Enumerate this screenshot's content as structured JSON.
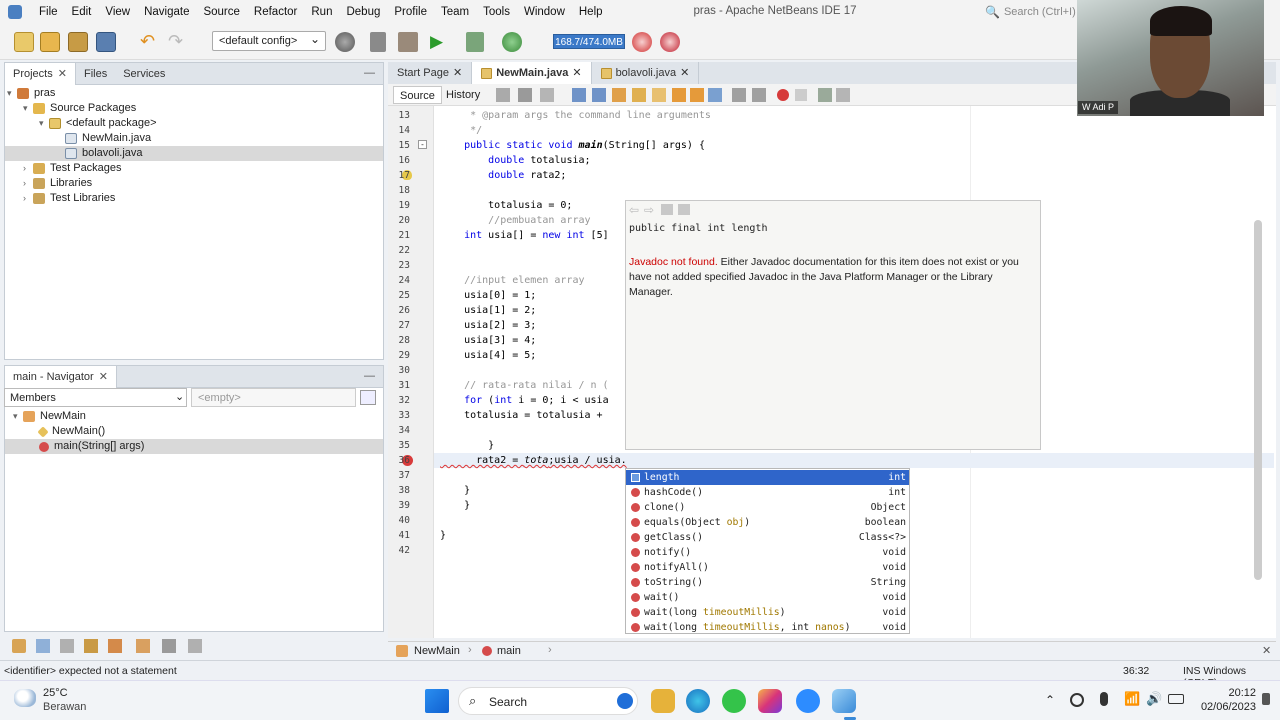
{
  "window": {
    "title": "pras - Apache NetBeans IDE 17"
  },
  "menu": [
    "File",
    "Edit",
    "View",
    "Navigate",
    "Source",
    "Refactor",
    "Run",
    "Debug",
    "Profile",
    "Team",
    "Tools",
    "Window",
    "Help"
  ],
  "search": {
    "placeholder": "Search (Ctrl+I)"
  },
  "toolbar": {
    "config": "<default config>",
    "memory": "168.7/474.0MB"
  },
  "projects_panel": {
    "tabs": [
      "Projects",
      "Files",
      "Services"
    ],
    "tree": [
      "pras",
      "Source Packages",
      "<default package>",
      "NewMain.java",
      "bolavoli.java",
      "Test Packages",
      "Libraries",
      "Test Libraries"
    ]
  },
  "navigator": {
    "title": "main - Navigator",
    "filter": "Members",
    "empty": "<empty>",
    "tree": [
      "NewMain",
      "NewMain()",
      "main(String[] args)"
    ]
  },
  "editor": {
    "tabs": [
      "Start Page",
      "NewMain.java",
      "bolavoli.java"
    ],
    "source_tab": "Source",
    "history_tab": "History",
    "lines": [
      {
        "n": "13",
        "t": "     * @param args the command line arguments"
      },
      {
        "n": "14",
        "t": "     */"
      },
      {
        "n": "15",
        "t": "    public static void main(String[] args) {"
      },
      {
        "n": "16",
        "t": "        double totalusia;"
      },
      {
        "n": "17",
        "t": "        double rata2;"
      },
      {
        "n": "18",
        "t": ""
      },
      {
        "n": "19",
        "t": "        totalusia = 0;"
      },
      {
        "n": "20",
        "t": "        //pembuatan array"
      },
      {
        "n": "21",
        "t": "    int usia[] = new int [5]"
      },
      {
        "n": "22",
        "t": ""
      },
      {
        "n": "23",
        "t": ""
      },
      {
        "n": "24",
        "t": "    //input elemen array"
      },
      {
        "n": "25",
        "t": "    usia[0] = 1;"
      },
      {
        "n": "26",
        "t": "    usia[1] = 2;"
      },
      {
        "n": "27",
        "t": "    usia[2] = 3;"
      },
      {
        "n": "28",
        "t": "    usia[3] = 4;"
      },
      {
        "n": "29",
        "t": "    usia[4] = 5;"
      },
      {
        "n": "30",
        "t": ""
      },
      {
        "n": "31",
        "t": "    // rata-rata nilai / n ("
      },
      {
        "n": "32",
        "t": "    for (int i = 0; i < usia"
      },
      {
        "n": "33",
        "t": "    totalusia = totalusia + "
      },
      {
        "n": "34",
        "t": ""
      },
      {
        "n": "35",
        "t": "        }"
      },
      {
        "n": "36",
        "t": "      rata2 = tota;usia / usia."
      },
      {
        "n": "37",
        "t": ""
      },
      {
        "n": "38",
        "t": "    }"
      },
      {
        "n": "39",
        "t": "    }"
      },
      {
        "n": "40",
        "t": ""
      },
      {
        "n": "41",
        "t": "}"
      },
      {
        "n": "42",
        "t": ""
      }
    ]
  },
  "javadoc": {
    "signature": "public final int length",
    "msg_red": "Javadoc not found.",
    "msg_rest": " Either Javadoc documentation for this item does not exist or you have not added specified Javadoc in the Java Platform Manager or the Library Manager."
  },
  "completion": [
    {
      "name": "length",
      "type": "int",
      "kind": "field"
    },
    {
      "name": "hashCode()",
      "type": "int",
      "kind": "method"
    },
    {
      "name": "clone()",
      "type": "Object",
      "kind": "method"
    },
    {
      "name": "equals(Object obj)",
      "type": "boolean",
      "kind": "method"
    },
    {
      "name": "getClass()",
      "type": "Class<?>",
      "kind": "method"
    },
    {
      "name": "notify()",
      "type": "void",
      "kind": "method"
    },
    {
      "name": "notifyAll()",
      "type": "void",
      "kind": "method"
    },
    {
      "name": "toString()",
      "type": "String",
      "kind": "method"
    },
    {
      "name": "wait()",
      "type": "void",
      "kind": "method"
    },
    {
      "name": "wait(long timeoutMillis)",
      "type": "void",
      "kind": "method"
    },
    {
      "name": "wait(long timeoutMillis, int nanos)",
      "type": "void",
      "kind": "method"
    }
  ],
  "breadcrumb": [
    "NewMain",
    "main"
  ],
  "status": {
    "message": "<identifier> expected  not a statement",
    "position": "36:32",
    "mode": "INS Windows (CRLF)"
  },
  "webcam": {
    "label": "W Adi P"
  },
  "taskbar": {
    "weather_temp": "25°C",
    "weather_desc": "Berawan",
    "search": "Search",
    "time": "20:12",
    "date": "02/06/2023"
  },
  "colors": {
    "accent": "#2f65ca",
    "keyword": "#0000e6",
    "comment": "#969696",
    "error": "#cc0000"
  }
}
